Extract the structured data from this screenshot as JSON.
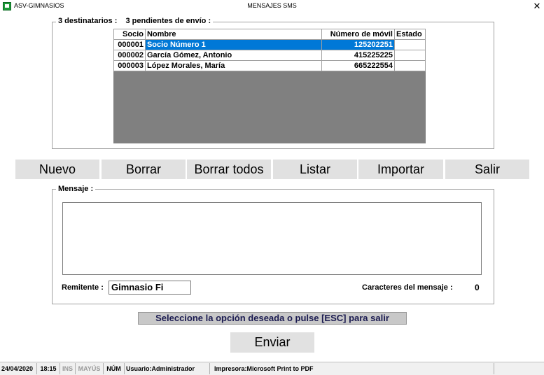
{
  "window": {
    "app_name": "ASV-GIMNASIOS",
    "title": "MENSAJES SMS",
    "close": "✕"
  },
  "recipients": {
    "count_label": "3 destinatarios :",
    "pending_label": "3 pendientes de envío :",
    "columns": [
      "Socio",
      "Nombre",
      "Número de móvil",
      "Estado"
    ],
    "rows": [
      {
        "socio": "000001",
        "nombre": "Socio Número 1",
        "movil": "125202251",
        "estado": ""
      },
      {
        "socio": "000002",
        "nombre": "García Gómez, Antonio",
        "movil": "415225225",
        "estado": ""
      },
      {
        "socio": "000003",
        "nombre": "López Morales, María",
        "movil": "665222554",
        "estado": ""
      }
    ]
  },
  "toolbar": {
    "nuevo": "Nuevo",
    "borrar": "Borrar",
    "borrar_todos": "Borrar todos",
    "listar": "Listar",
    "importar": "Importar",
    "salir": "Salir"
  },
  "message": {
    "legend": "Mensaje :",
    "text": "",
    "sender_label": "Remitente :",
    "sender_value": "Gimnasio Fi",
    "char_count_label": "Caracteres del mensaje :",
    "char_count": "0"
  },
  "hint": "Seleccione la opción deseada o pulse [ESC] para salir",
  "send_label": "Enviar",
  "status": {
    "date": "24/04/2020",
    "time": "18:15",
    "ins": "INS",
    "caps": "MAYÚS",
    "num": "NÚM",
    "user": "Usuario:Administrador",
    "printer": "Impresora:Microsoft Print to PDF"
  },
  "colors": {
    "selection": "#0078d7",
    "grid_bg": "#808080",
    "button_bg": "#e1e1e1",
    "app_icon": "#1e9b3a"
  }
}
